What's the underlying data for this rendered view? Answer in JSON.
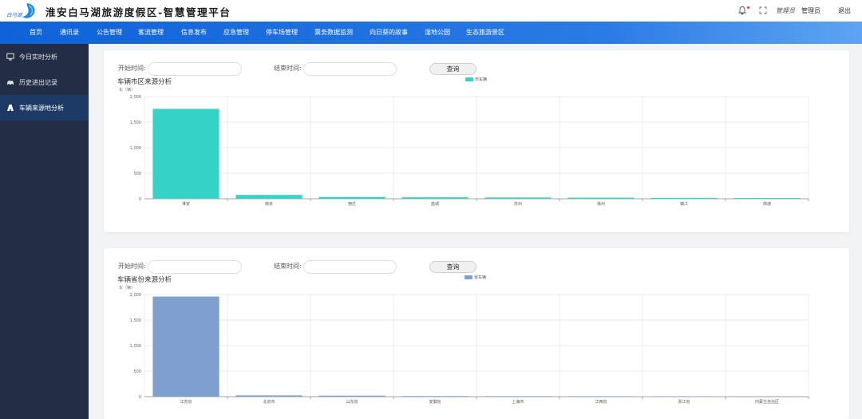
{
  "header": {
    "logo_text": "白马湖",
    "title": "淮安白马湖旅游度假区-智慧管理平台",
    "user_role": "管理员",
    "username": "管理员",
    "logout": "退出"
  },
  "nav": {
    "items": [
      "首页",
      "通讯录",
      "公告管理",
      "客流管理",
      "信息发布",
      "应急管理",
      "停车场管理",
      "票务数据监测",
      "向日葵的故事",
      "湿地公园",
      "生态旅游景区"
    ]
  },
  "sidebar": {
    "items": [
      {
        "label": "今日实时分析",
        "icon": "monitor-icon",
        "active": false
      },
      {
        "label": "历史进出记录",
        "icon": "car-icon",
        "active": false
      },
      {
        "label": "车辆来源地分析",
        "icon": "road-icon",
        "active": true
      }
    ]
  },
  "panels": [
    {
      "start_label": "开始时间:",
      "end_label": "结束时间:",
      "start_value": "",
      "end_value": "",
      "query_label": "查询",
      "title": "车辆市区来源分析",
      "unit": "车（辆）",
      "legend": "市车辆"
    },
    {
      "start_label": "开始时间:",
      "end_label": "结束时间:",
      "start_value": "",
      "end_value": "",
      "query_label": "查询",
      "title": "车辆省份来源分析",
      "unit": "车（辆）",
      "legend": "省车辆"
    }
  ],
  "chart_data": [
    {
      "type": "bar",
      "title": "车辆市区来源分析",
      "ylabel": "车（辆）",
      "categories": [
        "淮安",
        "南京",
        "宿迁",
        "盐城",
        "苏州",
        "徐州",
        "镇江",
        "南通"
      ],
      "series": [
        {
          "name": "市车辆",
          "values": [
            1760,
            75,
            35,
            28,
            25,
            22,
            18,
            15
          ]
        }
      ],
      "ylim": [
        0,
        2000
      ],
      "yticks": [
        0,
        500,
        1000,
        1500,
        2000
      ],
      "color": "#35d3c7",
      "legend_position": "top-center",
      "grid": true
    },
    {
      "type": "bar",
      "title": "车辆省份来源分析",
      "ylabel": "车（辆）",
      "categories": [
        "江苏省",
        "北京市",
        "山东省",
        "安徽省",
        "上海市",
        "江西省",
        "浙江省",
        "内蒙古自治区"
      ],
      "series": [
        {
          "name": "省车辆",
          "values": [
            1960,
            25,
            20,
            12,
            10,
            9,
            8,
            6
          ]
        }
      ],
      "ylim": [
        0,
        2000
      ],
      "yticks": [
        0,
        500,
        1000,
        1500,
        2000
      ],
      "color": "#7f9fd0",
      "legend_position": "top-center",
      "grid": true
    }
  ]
}
